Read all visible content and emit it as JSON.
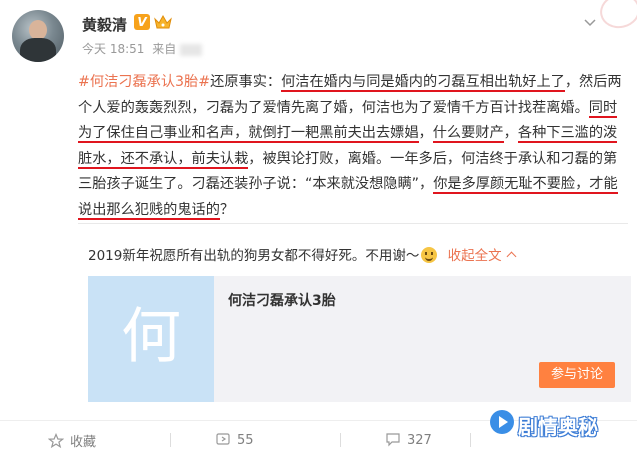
{
  "post": {
    "username": "黄毅清",
    "verify_badge": "V",
    "time": "今天 18:51",
    "source_prefix": "来自",
    "content": [
      {
        "t": "#何洁刁磊承认3胎#",
        "s": "link"
      },
      {
        "t": "还原事实：",
        "s": ""
      },
      {
        "t": "何洁在婚内与同是婚内的刁磊互相出轨好上了",
        "s": "ul"
      },
      {
        "t": "，然后两个人爱的轰轰烈烈，刁磊为了爱情先离了婚，何洁也为了爱情千方百计找茬离婚。",
        "s": ""
      },
      {
        "t": "同时为了保住自己事业和名声，就倒打一耙黑前夫出去嫖娼",
        "s": "ul"
      },
      {
        "t": "，",
        "s": ""
      },
      {
        "t": "什么要财产",
        "s": "ul"
      },
      {
        "t": "，",
        "s": ""
      },
      {
        "t": "各种下三滥的泼脏水，还不承认，前夫认栽",
        "s": "ul"
      },
      {
        "t": "，被舆论打败，离婚。一年多后，何洁终于承认和刁磊的第三胎孩子诞生了。刁磊还装孙子说：“本来就没想隐瞒”，",
        "s": ""
      },
      {
        "t": "你是多厚颜无耻不要脸，才能说出那么犯贱的鬼话的",
        "s": "ul"
      },
      {
        "t": "？",
        "s": ""
      }
    ],
    "second_line": "2019新年祝愿所有出轨的狗男女都不得好死。不用谢～",
    "collapse_label": "收起全文"
  },
  "card": {
    "thumb_char": "何",
    "title": "何洁刁磊承认3胎",
    "button_label": "参与讨论"
  },
  "footer": {
    "collect_label": "收藏",
    "repost_count": "55",
    "comment_count": "327"
  },
  "watermark": {
    "text": "剧情奥秘"
  },
  "colors": {
    "link": "#eb7350",
    "underline": "#e0151e",
    "button": "#ff8140",
    "card_bg": "#f2f2f5",
    "thumb_bg": "#c9e2f6"
  }
}
